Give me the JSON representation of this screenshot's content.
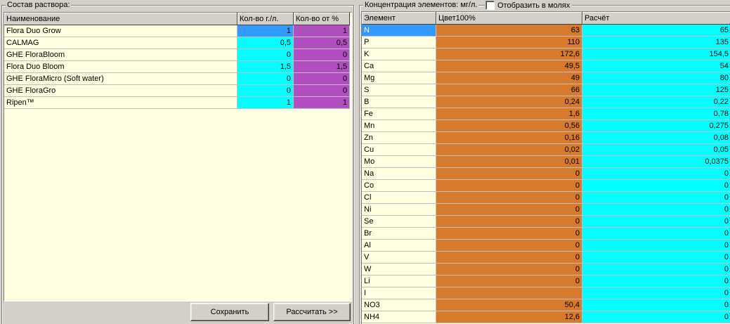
{
  "left_group": {
    "title": "Состав раствора:",
    "columns": [
      "Наименование",
      "Кол-во г./л.",
      "Кол-во от %"
    ],
    "rows": [
      {
        "name": "Flora Duo Grow",
        "qty": "1",
        "pct": "1"
      },
      {
        "name": "CALMAG",
        "qty": "0,5",
        "pct": "0,5"
      },
      {
        "name": "GHE FloraBloom",
        "qty": "0",
        "pct": "0"
      },
      {
        "name": "Flora Duo Bloom",
        "qty": "1,5",
        "pct": "1,5"
      },
      {
        "name": "GHE FloraMicro (Soft water)",
        "qty": "0",
        "pct": "0"
      },
      {
        "name": "GHE FloraGro",
        "qty": "0",
        "pct": "0"
      },
      {
        "name": "Ripen™",
        "qty": "1",
        "pct": "1"
      }
    ],
    "save_label": "Сохранить",
    "calc_label": "Рассчитать >>"
  },
  "right_group": {
    "title": "Концентрация элементов: мг/л.",
    "checkbox_label": "Отобразить в молях",
    "columns": [
      "Элемент",
      "Цвет100%",
      "Расчёт"
    ],
    "rows": [
      {
        "el": "N",
        "color": "63",
        "calc": "65"
      },
      {
        "el": "P",
        "color": "110",
        "calc": "135"
      },
      {
        "el": "K",
        "color": "172,6",
        "calc": "154,5"
      },
      {
        "el": "Ca",
        "color": "49,5",
        "calc": "54"
      },
      {
        "el": "Mg",
        "color": "49",
        "calc": "80"
      },
      {
        "el": "S",
        "color": "66",
        "calc": "125"
      },
      {
        "el": "B",
        "color": "0,24",
        "calc": "0,22"
      },
      {
        "el": "Fe",
        "color": "1,6",
        "calc": "0,78"
      },
      {
        "el": "Mn",
        "color": "0,56",
        "calc": "0,275"
      },
      {
        "el": "Zn",
        "color": "0,16",
        "calc": "0,08"
      },
      {
        "el": "Cu",
        "color": "0,02",
        "calc": "0,05"
      },
      {
        "el": "Mo",
        "color": "0,01",
        "calc": "0,0375"
      },
      {
        "el": "Na",
        "color": "0",
        "calc": "0"
      },
      {
        "el": "Co",
        "color": "0",
        "calc": "0"
      },
      {
        "el": "Cl",
        "color": "0",
        "calc": "0"
      },
      {
        "el": "Ni",
        "color": "0",
        "calc": "0"
      },
      {
        "el": "Se",
        "color": "0",
        "calc": "0"
      },
      {
        "el": "Br",
        "color": "0",
        "calc": "0"
      },
      {
        "el": "Al",
        "color": "0",
        "calc": "0"
      },
      {
        "el": "V",
        "color": "0",
        "calc": "0"
      },
      {
        "el": "W",
        "color": "0",
        "calc": "0"
      },
      {
        "el": "Li",
        "color": "0",
        "calc": "0"
      },
      {
        "el": "I",
        "color": "",
        "calc": "0"
      },
      {
        "el": "NO3",
        "color": "50,4",
        "calc": "0"
      },
      {
        "el": "NH4",
        "color": "12,6",
        "calc": "0"
      }
    ]
  },
  "colors": {
    "grid_bg": "#ffffe1",
    "cyan": "#00ffff",
    "purple": "#b24fc0",
    "orange": "#d87a2c",
    "selected": "#3399ff"
  }
}
